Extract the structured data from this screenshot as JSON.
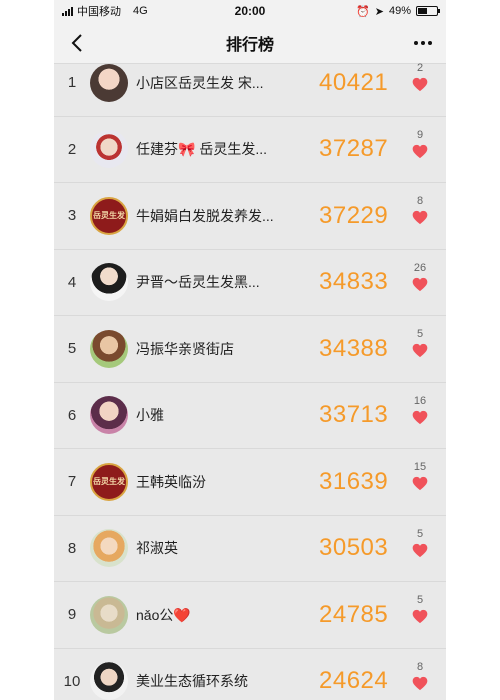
{
  "status_bar": {
    "carrier": "中国移动",
    "network": "4G",
    "time": "20:00",
    "battery": "49%",
    "battery_level": 0.49
  },
  "nav": {
    "title": "排行榜",
    "back_icon": "chevron-left-icon",
    "more_icon": "more-dots-icon"
  },
  "colors": {
    "score": "#f59a2a",
    "heart": "#f0525a"
  },
  "rows": [
    {
      "rank": "1",
      "name": "小店区岳灵生发  宋...",
      "score": "40421",
      "likes": "2",
      "avatar": "photo1"
    },
    {
      "rank": "2",
      "name": "任建芬🎀 岳灵生发...",
      "score": "37287",
      "likes": "9",
      "avatar": "photo2"
    },
    {
      "rank": "3",
      "name": "牛娟娟白发脱发养发...",
      "score": "37229",
      "likes": "8",
      "avatar": "logo",
      "avatar_text": "岳灵生发"
    },
    {
      "rank": "4",
      "name": "尹晋～岳灵生发黑...",
      "score": "34833",
      "likes": "26",
      "avatar": "photo3"
    },
    {
      "rank": "5",
      "name": "冯振华亲贤街店",
      "score": "34388",
      "likes": "5",
      "avatar": "photo4"
    },
    {
      "rank": "6",
      "name": "小雅",
      "score": "33713",
      "likes": "16",
      "avatar": "photo5"
    },
    {
      "rank": "7",
      "name": "王韩英临汾",
      "score": "31639",
      "likes": "15",
      "avatar": "logo",
      "avatar_text": "岳灵生发"
    },
    {
      "rank": "8",
      "name": "祁淑英",
      "score": "30503",
      "likes": "5",
      "avatar": "photo6"
    },
    {
      "rank": "9",
      "name": "nǎo公❤️",
      "score": "24785",
      "likes": "5",
      "avatar": "photo7"
    },
    {
      "rank": "10",
      "name": "美业生态循环系统",
      "score": "24624",
      "likes": "8",
      "avatar": "photo8"
    }
  ]
}
